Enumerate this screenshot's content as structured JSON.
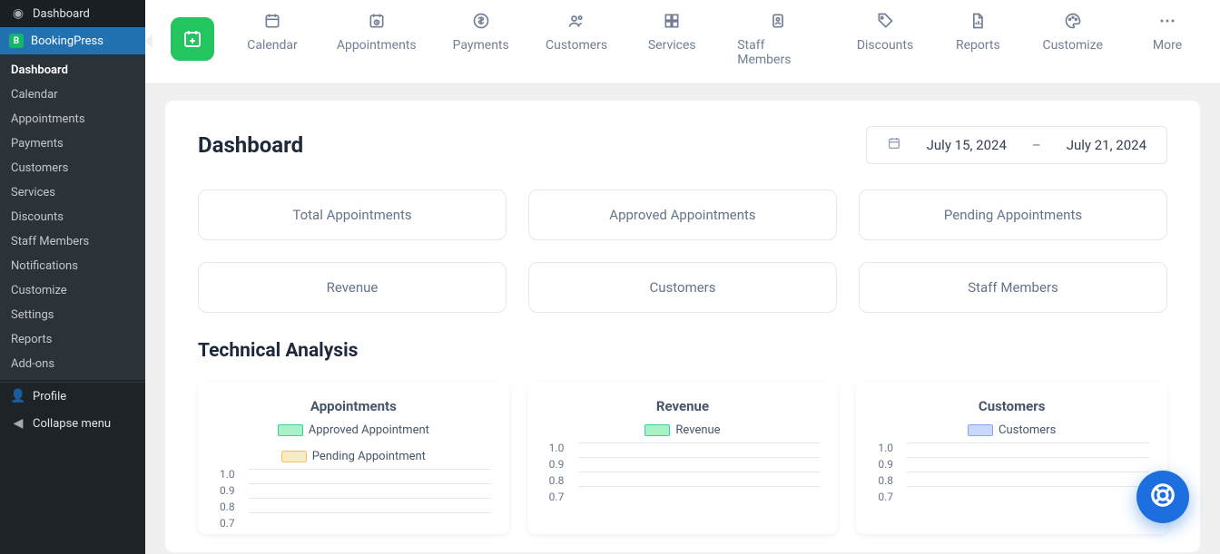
{
  "sidebar": {
    "links": [
      {
        "icon": "◷",
        "label": "Dashboard"
      }
    ],
    "active": {
      "label": "BookingPress"
    },
    "submenu": [
      "Dashboard",
      "Calendar",
      "Appointments",
      "Payments",
      "Customers",
      "Services",
      "Discounts",
      "Staff Members",
      "Notifications",
      "Customize",
      "Settings",
      "Reports",
      "Add-ons"
    ],
    "profile_label": "Profile",
    "collapse_label": "Collapse menu"
  },
  "topnav": {
    "items": [
      {
        "icon": "calendar",
        "label": "Calendar"
      },
      {
        "icon": "clock",
        "label": "Appointments"
      },
      {
        "icon": "dollar",
        "label": "Payments"
      },
      {
        "icon": "users",
        "label": "Customers"
      },
      {
        "icon": "grid",
        "label": "Services"
      },
      {
        "icon": "badge",
        "label": "Staff Members"
      },
      {
        "icon": "tag",
        "label": "Discounts"
      },
      {
        "icon": "report",
        "label": "Reports"
      },
      {
        "icon": "palette",
        "label": "Customize"
      },
      {
        "icon": "more",
        "label": "More"
      }
    ]
  },
  "dashboard": {
    "title": "Dashboard",
    "date_from": "July 15, 2024",
    "date_to": "July 21, 2024",
    "date_sep": "–",
    "cards": [
      "Total Appointments",
      "Approved Appointments",
      "Pending Appointments",
      "Revenue",
      "Customers",
      "Staff Members"
    ],
    "section2_title": "Technical Analysis"
  },
  "chart_data": [
    {
      "type": "line",
      "title": "Appointments",
      "series": [
        {
          "name": "Approved Appointment",
          "color": "green",
          "values": []
        },
        {
          "name": "Pending Appointment",
          "color": "orange",
          "values": []
        }
      ],
      "y_ticks": [
        "1.0",
        "0.9",
        "0.8",
        "0.7"
      ],
      "ylim": [
        0.7,
        1.0
      ]
    },
    {
      "type": "line",
      "title": "Revenue",
      "series": [
        {
          "name": "Revenue",
          "color": "green",
          "values": []
        }
      ],
      "y_ticks": [
        "1.0",
        "0.9",
        "0.8",
        "0.7"
      ],
      "ylim": [
        0.7,
        1.0
      ]
    },
    {
      "type": "line",
      "title": "Customers",
      "series": [
        {
          "name": "Customers",
          "color": "blue",
          "values": []
        }
      ],
      "y_ticks": [
        "1.0",
        "0.9",
        "0.8",
        "0.7"
      ],
      "ylim": [
        0.7,
        1.0
      ]
    }
  ]
}
